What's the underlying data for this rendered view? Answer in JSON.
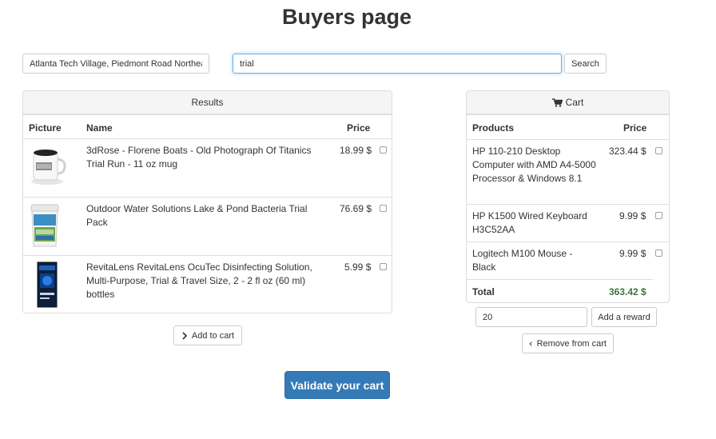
{
  "title": "Buyers page",
  "location": {
    "value": "Atlanta Tech Village, Piedmont Road Northeast"
  },
  "search": {
    "value": "trial",
    "button_label": "Search"
  },
  "results": {
    "heading": "Results",
    "columns": {
      "picture": "Picture",
      "name": "Name",
      "price": "Price"
    },
    "items": [
      {
        "name": "3dRose - Florene Boats - Old Photograph Of Titanics Trial Run - 11 oz mug",
        "price": "18.99 $",
        "image": "mug-image"
      },
      {
        "name": "Outdoor Water Solutions Lake & Pond Bacteria Trial Pack",
        "price": "76.69 $",
        "image": "bucket-image"
      },
      {
        "name": "RevitaLens RevitaLens OcuTec Disinfecting Solution, Multi-Purpose, Trial & Travel Size, 2 - 2 fl oz (60 ml) bottles",
        "price": "5.99 $",
        "image": "solution-box-image"
      }
    ],
    "add_button_label": "Add to cart"
  },
  "cart": {
    "heading": "Cart",
    "columns": {
      "products": "Products",
      "price": "Price"
    },
    "items": [
      {
        "name": "HP 110-210 Desktop Computer with AMD A4-5000 Processor & Windows 8.1",
        "price": "323.44 $"
      },
      {
        "name": "HP K1500 Wired Keyboard H3C52AA",
        "price": "9.99 $"
      },
      {
        "name": "Logitech M100 Mouse - Black",
        "price": "9.99 $"
      }
    ],
    "total_label": "Total",
    "total_value": "363.42 $",
    "reward_value": "20",
    "reward_button_label": "Add a reward",
    "remove_button_label": "Remove from cart"
  },
  "validate_button_label": "Validate your cart",
  "colors": {
    "primary": "#337ab7",
    "total": "#3c763d",
    "focus": "#66afe9"
  }
}
